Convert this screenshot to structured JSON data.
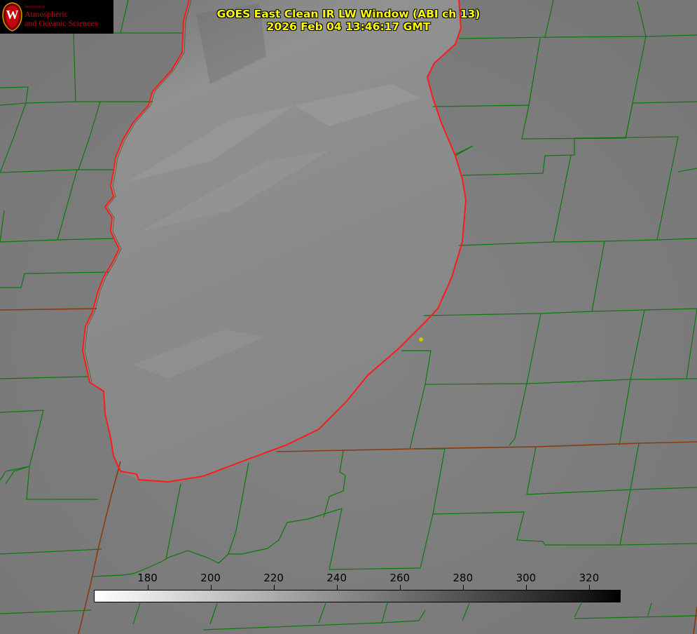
{
  "title": {
    "line1": "GOES East Clean IR LW Window (ABI ch 13)",
    "line2": "2026 Feb 04 13:46:17 GMT"
  },
  "logo": {
    "department": "Department of",
    "line1": "Atmospheric",
    "line2": "and Oceanic Sciences",
    "seal_letter": "W"
  },
  "colorbar": {
    "ticks": [
      "180",
      "200",
      "220",
      "240",
      "260",
      "280",
      "300",
      "320"
    ],
    "min": 163,
    "max": 330,
    "colors": {
      "low": "#ffffff",
      "high": "#000000"
    }
  },
  "map": {
    "colors": {
      "background": "#7e7e7e",
      "lake": "#8d8d8d",
      "county_lines": "#0a7a0a",
      "state_lines": "#8a3a10",
      "lake_shore": "#ff1a1a",
      "marker": "#d4c400"
    },
    "marker_icon": "yellow-dot"
  }
}
